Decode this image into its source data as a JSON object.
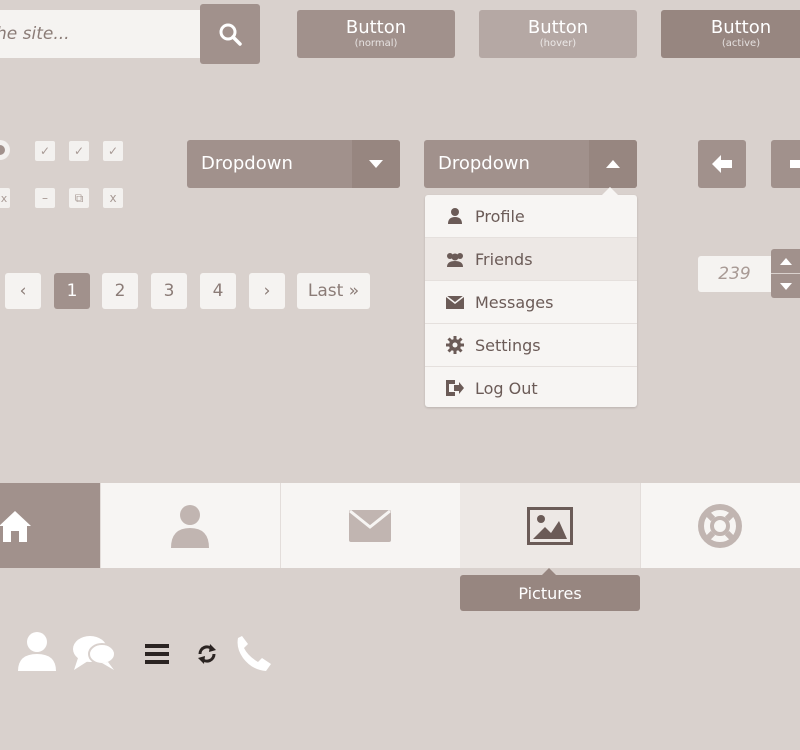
{
  "search": {
    "placeholder_visible": "he site...",
    "icon": "search-icon"
  },
  "buttons": [
    {
      "label": "Button",
      "state": "(normal)",
      "bg": "#a1918c"
    },
    {
      "label": "Button",
      "state": "(hover)",
      "bg": "#b5a8a4"
    },
    {
      "label": "Button",
      "state": "(active)",
      "bg": "#978680"
    }
  ],
  "checkboxes": {
    "row1": [
      "✓",
      "✓",
      "✓"
    ],
    "row2": [
      "–",
      "⧉",
      "x"
    ]
  },
  "dropdown1": {
    "label": "Dropdown"
  },
  "dropdown2": {
    "label": "Dropdown"
  },
  "menu": {
    "items": [
      {
        "label": "Profile",
        "icon": "user-icon"
      },
      {
        "label": "Friends",
        "icon": "group-icon"
      },
      {
        "label": "Messages",
        "icon": "envelope-icon"
      },
      {
        "label": "Settings",
        "icon": "gear-icon"
      },
      {
        "label": "Log Out",
        "icon": "logout-icon"
      }
    ]
  },
  "pagination": {
    "prev": "‹",
    "pages": [
      "1",
      "2",
      "3",
      "4"
    ],
    "next": "›",
    "last": "Last »",
    "active_page": "1"
  },
  "spinner": {
    "value": "239"
  },
  "tabs": [
    {
      "icon": "home-icon"
    },
    {
      "icon": "user-icon"
    },
    {
      "icon": "envelope-icon"
    },
    {
      "icon": "picture-icon"
    },
    {
      "icon": "lifebuoy-icon"
    }
  ],
  "tooltip": {
    "label": "Pictures"
  },
  "icon_row": [
    "user-icon",
    "chat-icon",
    "menu-icon",
    "refresh-icon",
    "phone-icon"
  ],
  "colors": {
    "accent": "#a1918c",
    "background": "#d9d1cd",
    "light": "#f5f3f1"
  }
}
